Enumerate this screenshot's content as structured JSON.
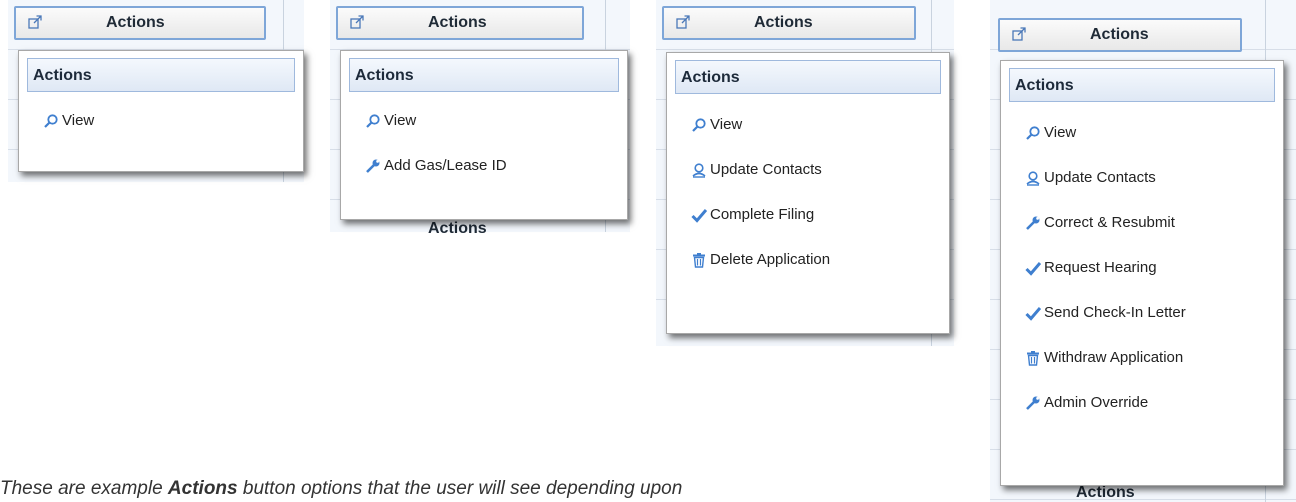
{
  "button_label": "Actions",
  "menu_title": "Actions",
  "panels": [
    {
      "items": [
        {
          "icon": "search-icon",
          "label": "View"
        }
      ]
    },
    {
      "items": [
        {
          "icon": "search-icon",
          "label": "View"
        },
        {
          "icon": "wrench-icon",
          "label": "Add Gas/Lease ID"
        }
      ]
    },
    {
      "items": [
        {
          "icon": "search-icon",
          "label": "View"
        },
        {
          "icon": "person-icon",
          "label": "Update Contacts"
        },
        {
          "icon": "check-icon",
          "label": "Complete Filing"
        },
        {
          "icon": "trash-icon",
          "label": "Delete Application"
        }
      ]
    },
    {
      "items": [
        {
          "icon": "search-icon",
          "label": "View"
        },
        {
          "icon": "person-icon",
          "label": "Update Contacts"
        },
        {
          "icon": "wrench-icon",
          "label": "Correct & Resubmit"
        },
        {
          "icon": "check-icon",
          "label": "Request Hearing"
        },
        {
          "icon": "check-icon",
          "label": "Send Check-In Letter"
        },
        {
          "icon": "trash-icon",
          "label": "Withdraw Application"
        },
        {
          "icon": "wrench-icon",
          "label": "Admin Override"
        }
      ]
    }
  ],
  "peek_label": "Actions",
  "caption": {
    "before": "These are example ",
    "bold": "Actions",
    "after": " button options that the user will see depending upon"
  },
  "colors": {
    "accent": "#7ea6d8",
    "icon_blue": "#3f7fcf",
    "header_bg": "#dfe8f5"
  }
}
